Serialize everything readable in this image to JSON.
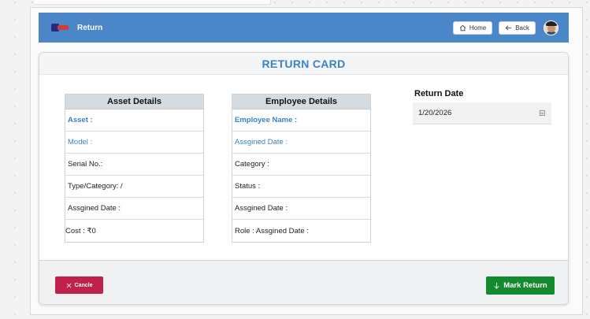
{
  "header": {
    "title": "Return",
    "home_label": "Home",
    "back_label": "Back",
    "color": "#4a86c8"
  },
  "card": {
    "title": "RETURN CARD"
  },
  "asset_details": {
    "title": "Asset Details",
    "rows": [
      "Asset :",
      "Model :",
      "Serial No.:",
      "Type/Category: /",
      "Assgined Date :",
      "Cost : ₹0"
    ]
  },
  "employee_details": {
    "title": "Employee Details",
    "rows": [
      "Employee Name :",
      "Assgined Date :",
      "Category :",
      "Status :",
      "Assgined Date :",
      "Role :  Assgined Date :"
    ]
  },
  "return_date": {
    "label": "Return Date",
    "value": "1/20/2026"
  },
  "footer": {
    "cancel_label": "Cancle",
    "mark_return_label": "Mark Return",
    "cancel_color": "#c0214a",
    "mark_color": "#138a2e"
  }
}
